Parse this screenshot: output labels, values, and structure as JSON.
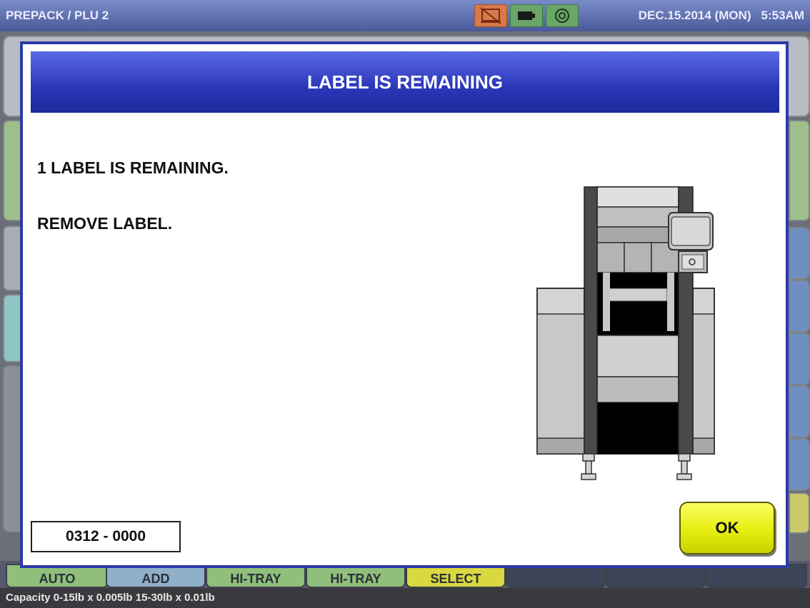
{
  "topbar": {
    "title": "PREPACK / PLU 2",
    "date": "DEC.15.2014 (MON)",
    "time": "5:53AM",
    "status_icons": [
      "printer-error-icon",
      "battery-icon",
      "network-icon"
    ]
  },
  "dialog": {
    "title": "LABEL IS REMAINING",
    "message_line1": "1 LABEL IS REMAINING.",
    "message_line2": "REMOVE LABEL.",
    "error_code": "0312 - 0000",
    "ok_label": "OK",
    "illustration": "label-printer-machine-icon"
  },
  "bottom_buttons": [
    {
      "label": "AUTO",
      "color": "#8fbf7a"
    },
    {
      "label": "ADD",
      "color": "#8fb0c8"
    },
    {
      "label": "HI-TRAY",
      "color": "#8fbf7a"
    },
    {
      "label": "HI-TRAY",
      "color": "#8fbf7a"
    },
    {
      "label": "SELECT",
      "color": "#d8d840"
    }
  ],
  "capacity_text": "Capacity 0-15lb x 0.005lb  15-30lb x 0.01lb",
  "colors": {
    "dialog_header": "#2a36b8",
    "ok_button": "#e6ee10",
    "topbar": "#5a6aaa"
  }
}
